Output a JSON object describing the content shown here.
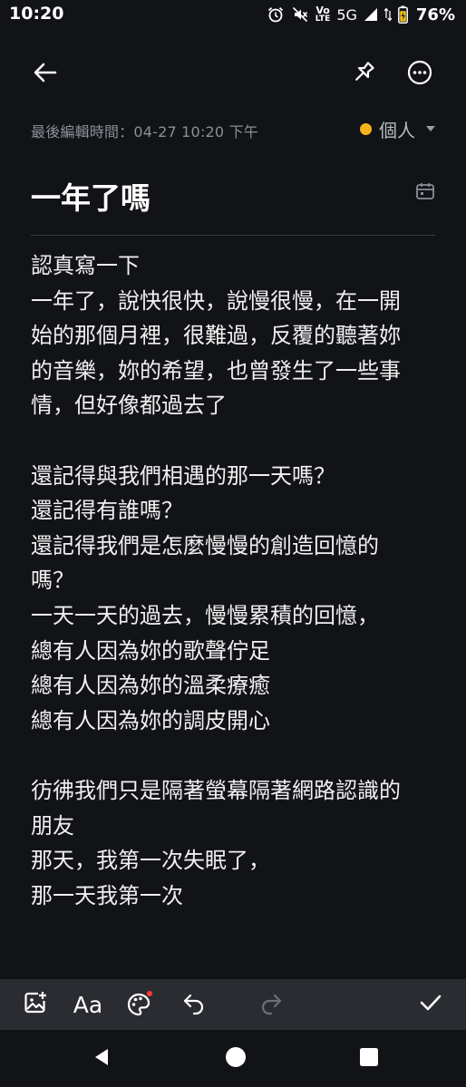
{
  "status_bar": {
    "time": "10:20",
    "volte_top": "Vo",
    "volte_bottom": "LTE",
    "network": "5G",
    "battery": "76%"
  },
  "toolbar": {
    "icons": [
      "back-arrow-icon",
      "pin-icon",
      "more-options-icon"
    ]
  },
  "note": {
    "edit_info": "最後編輯時間：04-27 10:20 下午",
    "folder_label": "個人",
    "folder_color": "#f5b41a",
    "title": "一年了嗎",
    "lines": [
      "認真寫一下",
      "一年了，說快很快，說慢很慢，在一開",
      "始的那個月裡，很難過，反覆的聽著妳",
      "的音樂，妳的希望，也曾發生了一些事",
      "情，但好像都過去了",
      "",
      "還記得與我們相遇的那一天嗎？",
      "還記得有誰嗎？",
      "還記得我們是怎麼慢慢的創造回憶的",
      "嗎？",
      "一天一天的過去，慢慢累積的回憶，",
      "總有人因為妳的歌聲佇足",
      "總有人因為妳的溫柔療癒",
      "總有人因為妳的調皮開心",
      "",
      "彷彿我們只是隔著螢幕隔著網路認識的",
      "朋友",
      "那天，我第一次失眠了，",
      "那一天我第一次"
    ]
  },
  "edit_bar": {
    "text_style_label": "Aa",
    "icons": [
      "image-add-icon",
      "text-format-icon",
      "palette-icon",
      "undo-icon",
      "redo-icon",
      "checkmark-icon"
    ],
    "accent_color": "#ff3b30"
  },
  "nav_bar": {
    "icons": [
      "back-triangle-icon",
      "home-circle-icon",
      "recents-square-icon"
    ]
  }
}
